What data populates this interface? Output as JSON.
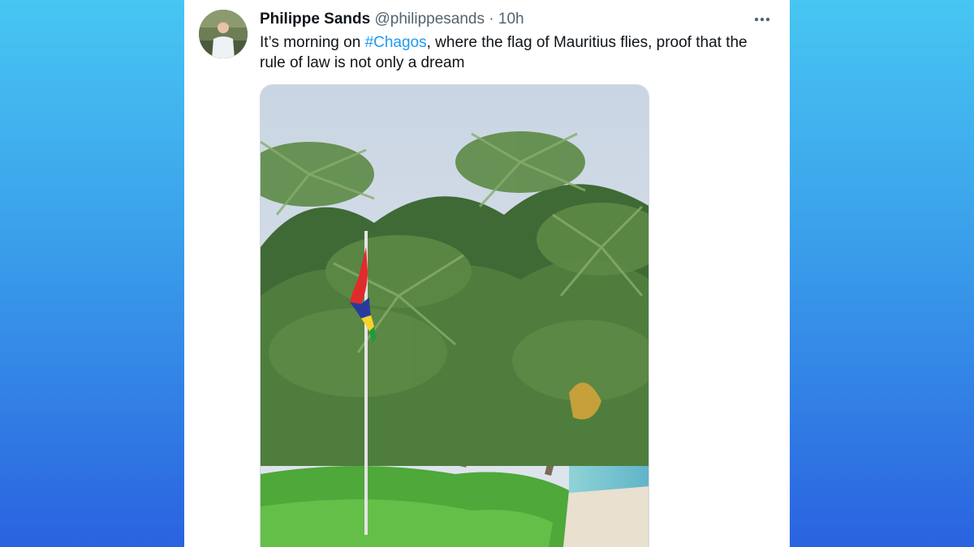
{
  "tweet": {
    "author_name": "Philippe Sands",
    "handle": "@philippesands",
    "separator": "·",
    "time": "10h",
    "text_before": "It’s morning on ",
    "hashtag": "#Chagos",
    "text_after": ", where the flag of Mauritius flies, proof that the rule of law is not only a dream",
    "more_icon": "more-horizontal-icon"
  },
  "media": {
    "flag_colors": [
      "#e12b2b",
      "#2a3a9c",
      "#f4d32b",
      "#1e9a3a"
    ]
  },
  "colors": {
    "link": "#1d9bf0",
    "secondary_text": "#536471",
    "background_top": "#47c6f2",
    "background_bottom": "#2a63e0"
  }
}
